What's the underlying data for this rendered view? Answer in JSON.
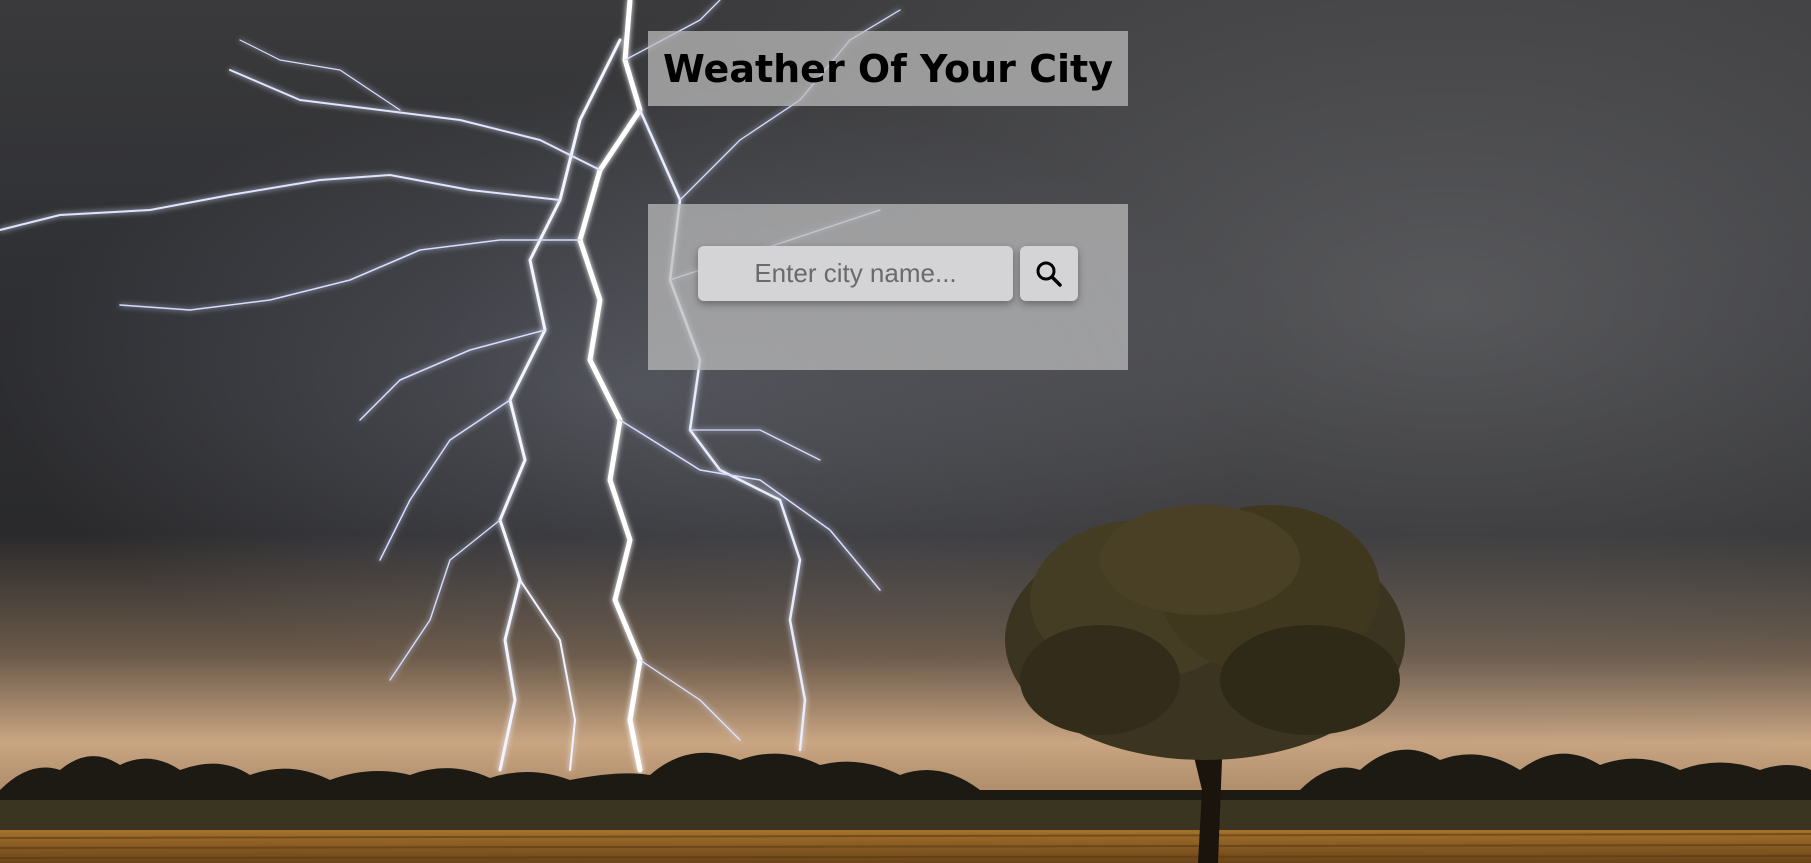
{
  "header": {
    "title": "Weather Of Your City"
  },
  "search": {
    "placeholder": "Enter city name...",
    "value": "",
    "button_icon": "search-icon"
  },
  "background": {
    "scene": "lightning-storm-field-tree"
  }
}
